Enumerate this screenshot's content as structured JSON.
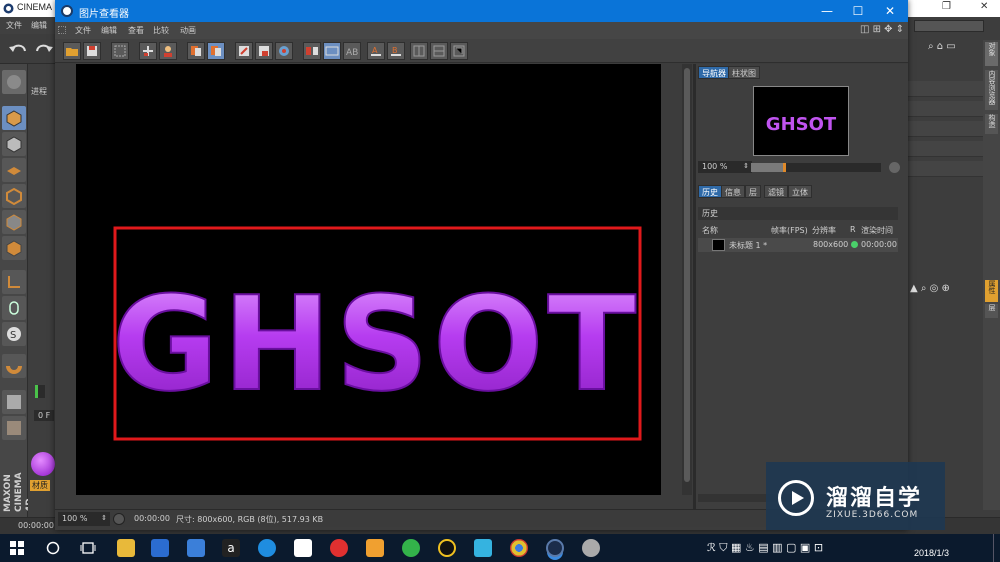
{
  "c4d": {
    "title": "CINEMA",
    "menu": [
      "文件",
      "编辑"
    ],
    "left_labels": [
      "进程",
      "0 F",
      "材质"
    ],
    "bottom_time": "00:00:00",
    "logo_brand": "MAXON",
    "logo_product": "CINEMA 4D",
    "right_vertical_tabs": [
      "对象",
      "内容浏览器",
      "构造",
      "属性",
      "层"
    ]
  },
  "viewer": {
    "title": "图片查看器",
    "window_buttons": {
      "minimize": "—",
      "maximize": "☐",
      "close": "✕"
    },
    "menu": [
      "文件",
      "编辑",
      "查看",
      "比较",
      "动画"
    ],
    "image_text": "GHSOT",
    "image_text_color": "#b63cf0",
    "frame_color": "#e0191b",
    "status": {
      "zoom": "100 %",
      "time": "00:00:00",
      "info": "尺寸: 800x600, RGB (8位), 517.93 KB"
    },
    "nav_tabs": [
      "导航器",
      "柱状图"
    ],
    "nav_zoom": "100 %",
    "nav_zoom_level": 0.25,
    "hist_tabs": [
      "历史",
      "信息",
      "层",
      "滤镜",
      "立体"
    ],
    "hist_header": "历史",
    "hist_columns": [
      "名称",
      "帧率(FPS)",
      "分辨率",
      "R",
      "渲染时间"
    ],
    "hist_row": {
      "name": "未标题 1 *",
      "resolution": "800x600",
      "render_time": "00:00:00",
      "status_color": "#4ad06a"
    }
  },
  "taskbar": {
    "date": "2018/1/3",
    "icons": [
      "windows-icon",
      "search-icon",
      "taskview-icon",
      "explorer-icon",
      "store-icon",
      "monitor-icon",
      "amazon-icon",
      "edge-icon",
      "mail-icon",
      "netease-icon",
      "app-icon",
      "wechat-icon",
      "qq-icon",
      "player-icon",
      "chrome-icon",
      "cinema4d-icon",
      "picture-viewer-icon"
    ]
  },
  "watermark": {
    "name": "溜溜自学",
    "url": "ZIXUE.3D66.COM"
  }
}
